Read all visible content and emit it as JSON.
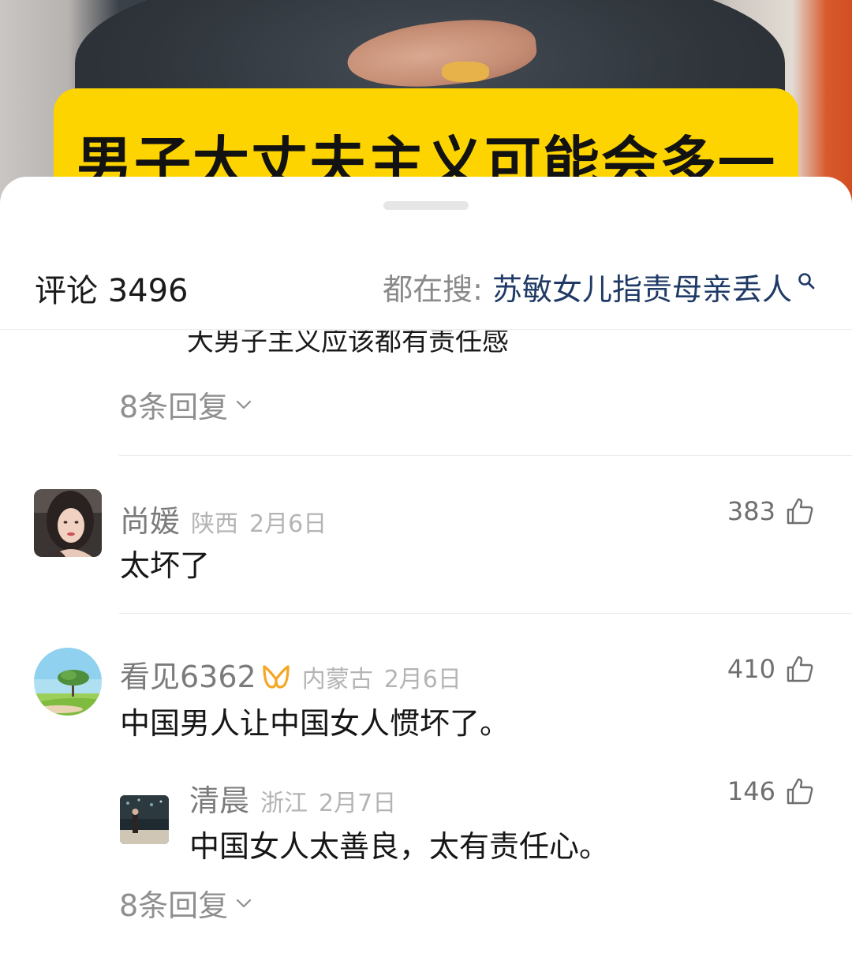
{
  "video": {
    "caption": "男子大丈夫主义可能会多一"
  },
  "sheet": {
    "comment_count": "评论 3496",
    "hot_search_prefix": "都在搜:",
    "hot_search_keyword": "苏敏女儿指责母亲丢人"
  },
  "thread_top": {
    "partial_text": "大男子主义应该都有责任感",
    "replies_label": "8条回复"
  },
  "comments": [
    {
      "username": "尚媛",
      "location": "陕西",
      "date": "2月6日",
      "likes": "383",
      "text": "太坏了"
    },
    {
      "username": "看见6362",
      "location": "内蒙古",
      "date": "2月6日",
      "likes": "410",
      "text": "中国男人让中国女人惯坏了。",
      "badge_color": "#f5a623",
      "reply": {
        "username": "清晨",
        "location": "浙江",
        "date": "2月7日",
        "likes": "146",
        "text": "中国女人太善良，太有责任心。"
      },
      "replies_label": "8条回复"
    }
  ]
}
